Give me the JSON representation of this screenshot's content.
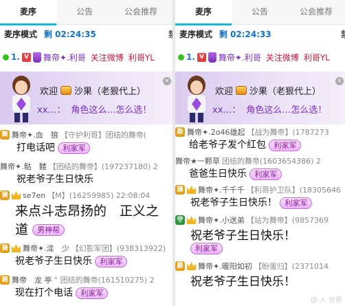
{
  "left": {
    "tabs": [
      "麦序",
      "公告",
      "公会推荐"
    ],
    "mode_label": "麦序模式",
    "timer": "剩 02:24:35",
    "extra": "禁",
    "queue": {
      "num": "1.",
      "vip": "V",
      "name": "舞帝✦.利哥",
      "action": "关注微博",
      "trail": "利哥YL"
    },
    "welcome": {
      "prefix": "欢迎",
      "user": "沙果（老狠代上）",
      "sender": "xx…：",
      "question": "角色这么…怎么选！"
    },
    "messages": [
      {
        "rank": "舞",
        "meta": "舞帝✦.血　狼",
        "info": "【守护利哥】团结的舞帝(",
        "text": "打电话吧",
        "tag": "利家军"
      },
      {
        "rank": "",
        "meta": "舞帝✦.骷　髅",
        "info": "【团结的舞帝】(197237180) 2",
        "text": "祝老爷子生日快乐",
        "tag": ""
      },
      {
        "rank": "骑",
        "meta": "se7en",
        "info": "【M】(16259985) 22:08:04",
        "text": "来点斗志昂扬的　正义之",
        "tag": ""
      },
      {
        "rank": "",
        "meta": "",
        "info": "",
        "text": "道",
        "tag": "男神帮"
      },
      {
        "rank": "骑",
        "meta": "舞帝✦.渁　少",
        "info": "【幻影军团】(938313922)",
        "text": "祝老爷子生日快乐",
        "tag": "利家军"
      },
      {
        "rank": "骑",
        "meta": "舞帝　龙 亭",
        "info": "° 团结的舞帝(161510275) 2",
        "text": "现在打个电话",
        "tag": "利家军"
      }
    ]
  },
  "right": {
    "tabs": [
      "麦序",
      "公告",
      "公会推荐"
    ],
    "mode_label": "麦序模式",
    "timer": "剩 02:24:33",
    "extra": "禁",
    "queue": {
      "num": "1.",
      "vip": "V",
      "name": "舞帝✦.利哥",
      "action": "关注微博",
      "trail": "利哥YL"
    },
    "welcome": {
      "prefix": "欢迎",
      "user": "沙果（老狠代上）",
      "sender": "xx…：",
      "question": "角色这么…怎么选！"
    },
    "messages": [
      {
        "rank": "勋",
        "meta": "舞帝✦.2o46雄起",
        "info": "【战为舞帝】(1787273",
        "text": "给老爷子发个红包",
        "tag": "利家军"
      },
      {
        "rank": "",
        "meta": "舞帝★一颗草",
        "info": "团结的舞帝(1603654386) 2",
        "text": "爸爸生日快乐",
        "tag": "利家军"
      },
      {
        "rank": "骑",
        "meta": "舞帝✦.千千千",
        "info": "【利哥护卫队】(18305646",
        "text": "祝老爷子生日快乐！",
        "tag": "利家军"
      },
      {
        "rank": "守",
        "meta": "舞帝✦.小送弟",
        "info": "【站为舞帝】(9857369",
        "text": "祝老爷子生日快乐！",
        "tag": ""
      },
      {
        "rank": "",
        "meta": "",
        "info": "",
        "text": "",
        "tag": "利家军"
      },
      {
        "rank": "爵",
        "meta": "舞帝✦.暖阳如初",
        "info": "【盼蛋归】(2371014",
        "text": "祝老爷子生日快乐！",
        "tag": ""
      }
    ]
  },
  "watermark": "值·人·世界"
}
